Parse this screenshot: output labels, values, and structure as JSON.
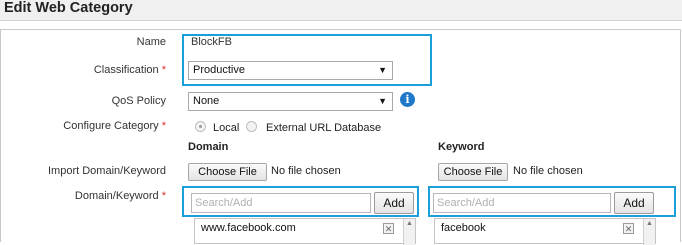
{
  "header": {
    "title": "Edit Web Category"
  },
  "form": {
    "name": {
      "label": "Name",
      "value": "BlockFB"
    },
    "classification": {
      "label": "Classification",
      "required": "*",
      "value": "Productive"
    },
    "qos": {
      "label": "QoS Policy",
      "value": "None",
      "info_icon": "info-icon"
    },
    "configure": {
      "label": "Configure Category",
      "required": "*",
      "options": [
        "Local",
        "External URL Database"
      ],
      "selected": "Local"
    },
    "columns": {
      "domain": "Domain",
      "keyword": "Keyword"
    },
    "import": {
      "label": "Import Domain/Keyword",
      "choose_file": "Choose File",
      "no_file": "No file chosen"
    },
    "domain_keyword": {
      "label": "Domain/Keyword",
      "required": "*",
      "domain_placeholder": "Search/Add",
      "keyword_placeholder": "Search/Add",
      "add_label": "Add",
      "domain_items": [
        "www.facebook.com"
      ],
      "keyword_items": [
        "facebook"
      ]
    }
  },
  "colors": {
    "highlight": "#1a9fd9",
    "required": "#d9302c",
    "info": "#1f78c8"
  }
}
